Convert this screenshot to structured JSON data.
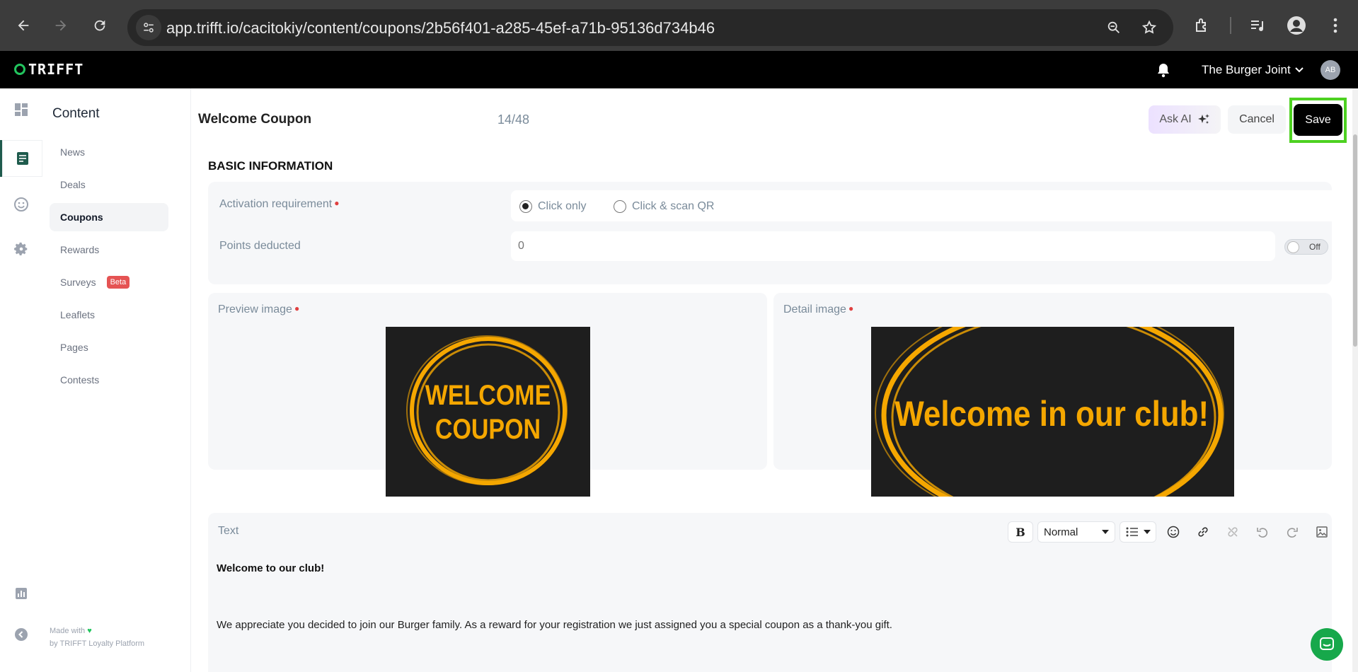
{
  "browser": {
    "url": "app.trifft.io/cacitokiy/content/coupons/2b56f401-a285-45ef-a71b-95136d734b46"
  },
  "header": {
    "logo": "TRIFFT",
    "account_name": "The Burger Joint",
    "avatar_initials": "AB"
  },
  "sidenav": {
    "title": "Content",
    "items": [
      {
        "label": "News"
      },
      {
        "label": "Deals"
      },
      {
        "label": "Coupons",
        "active": true
      },
      {
        "label": "Rewards"
      },
      {
        "label": "Surveys",
        "badge": "Beta"
      },
      {
        "label": "Leaflets"
      },
      {
        "label": "Pages"
      },
      {
        "label": "Contests"
      }
    ],
    "made_with": "Made with",
    "platform": "by TRIFFT Loyalty Platform"
  },
  "editor": {
    "title": "Welcome Coupon",
    "counter": "14/48",
    "ask_ai_label": "Ask AI",
    "cancel_label": "Cancel",
    "save_label": "Save",
    "section_heading": "BASIC INFORMATION",
    "activation": {
      "label": "Activation requirement",
      "options": [
        "Click only",
        "Click & scan QR"
      ],
      "selected": "Click only"
    },
    "points": {
      "label": "Points deducted",
      "placeholder": "0",
      "toggle_label": "Off"
    },
    "preview_image": {
      "label": "Preview image",
      "line1": "WELCOME",
      "line2": "COUPON"
    },
    "detail_image": {
      "label": "Detail image",
      "text": "Welcome in our club!"
    },
    "text_field": {
      "label": "Text",
      "format_select": "Normal",
      "heading": "Welcome to our club!",
      "body": "We appreciate you decided to join our Burger family. As a reward for your registration we just assigned you a special coupon as a thank-you gift."
    }
  },
  "colors": {
    "accent_green": "#4dd121",
    "brand_green": "#22c55e",
    "coupon_orange": "#f5a700",
    "required_red": "#e04040"
  }
}
